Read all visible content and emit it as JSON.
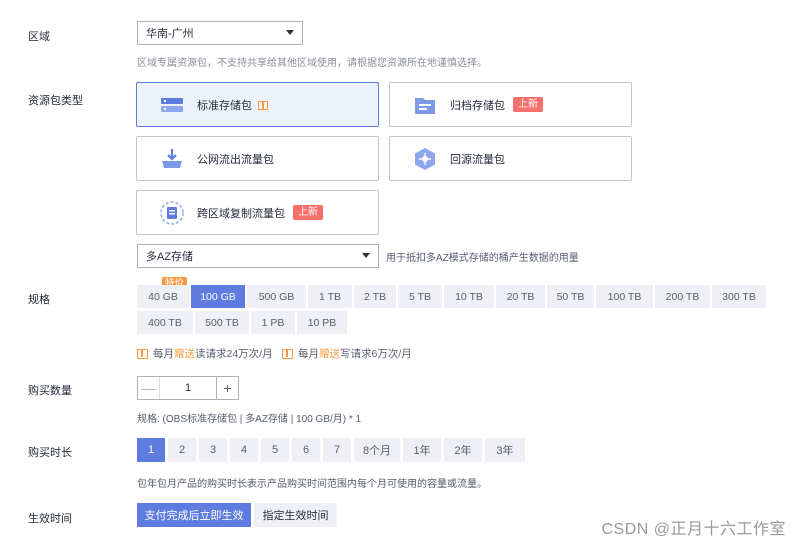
{
  "region": {
    "label": "区域",
    "selected": "华南-广州",
    "hint": "区域专属资源包，不支持共享给其他区域使用，请根据您资源所在地谨慎选择。"
  },
  "package_type": {
    "label": "资源包类型",
    "cards": [
      {
        "label": "标准存储包",
        "icon": "standard-storage-icon",
        "selected": true,
        "gift": true,
        "badge": ""
      },
      {
        "label": "归档存储包",
        "icon": "archive-storage-icon",
        "selected": false,
        "gift": false,
        "badge": "上新"
      },
      {
        "label": "公网流出流量包",
        "icon": "public-outbound-icon",
        "selected": false,
        "gift": false,
        "badge": ""
      },
      {
        "label": "回源流量包",
        "icon": "origin-traffic-icon",
        "selected": false,
        "gift": false,
        "badge": ""
      },
      {
        "label": "跨区域复制流量包",
        "icon": "cross-region-icon",
        "selected": false,
        "gift": false,
        "badge": "上新"
      }
    ],
    "storage_select": "多AZ存储",
    "storage_hint": "用于抵扣多AZ模式存储的桶产生数据的用量"
  },
  "spec": {
    "label": "规格",
    "special_tag": "特价",
    "sizes": [
      "40 GB",
      "100 GB",
      "500 GB",
      "1 TB",
      "2 TB",
      "5 TB",
      "10 TB",
      "20 TB",
      "50 TB",
      "100 TB",
      "200 TB",
      "300 TB",
      "400 TB",
      "500 TB",
      "1 PB",
      "10 PB"
    ],
    "active_index": 1,
    "gift_read_prefix": "每月",
    "gift_read_hl": "赠送",
    "gift_read_suffix": "读请求24万次/月",
    "gift_write_prefix": "每月",
    "gift_write_hl": "赠送",
    "gift_write_suffix": "写请求6万次/月"
  },
  "quantity": {
    "label": "购买数量",
    "value": "1",
    "minus": "—",
    "plus": "+",
    "summary": "规格: (OBS标准存储包 | 多AZ存储 | 100 GB/月) * 1"
  },
  "duration": {
    "label": "购买时长",
    "options": [
      "1",
      "2",
      "3",
      "4",
      "5",
      "6",
      "7",
      "8个月",
      "1年",
      "2年",
      "3年"
    ],
    "active_index": 0,
    "hint": "包年包月产品的购买时长表示产品购买时间范围内每个月可使用的容量或流量。"
  },
  "effective": {
    "label": "生效时间",
    "options": [
      "支付完成后立即生效",
      "指定生效时间"
    ],
    "active_index": 0
  },
  "watermark": "CSDN @正月十六工作室",
  "colors": {
    "accent": "#5e7ce0",
    "orange": "#fa9841",
    "badge_red": "#f66f6a"
  }
}
